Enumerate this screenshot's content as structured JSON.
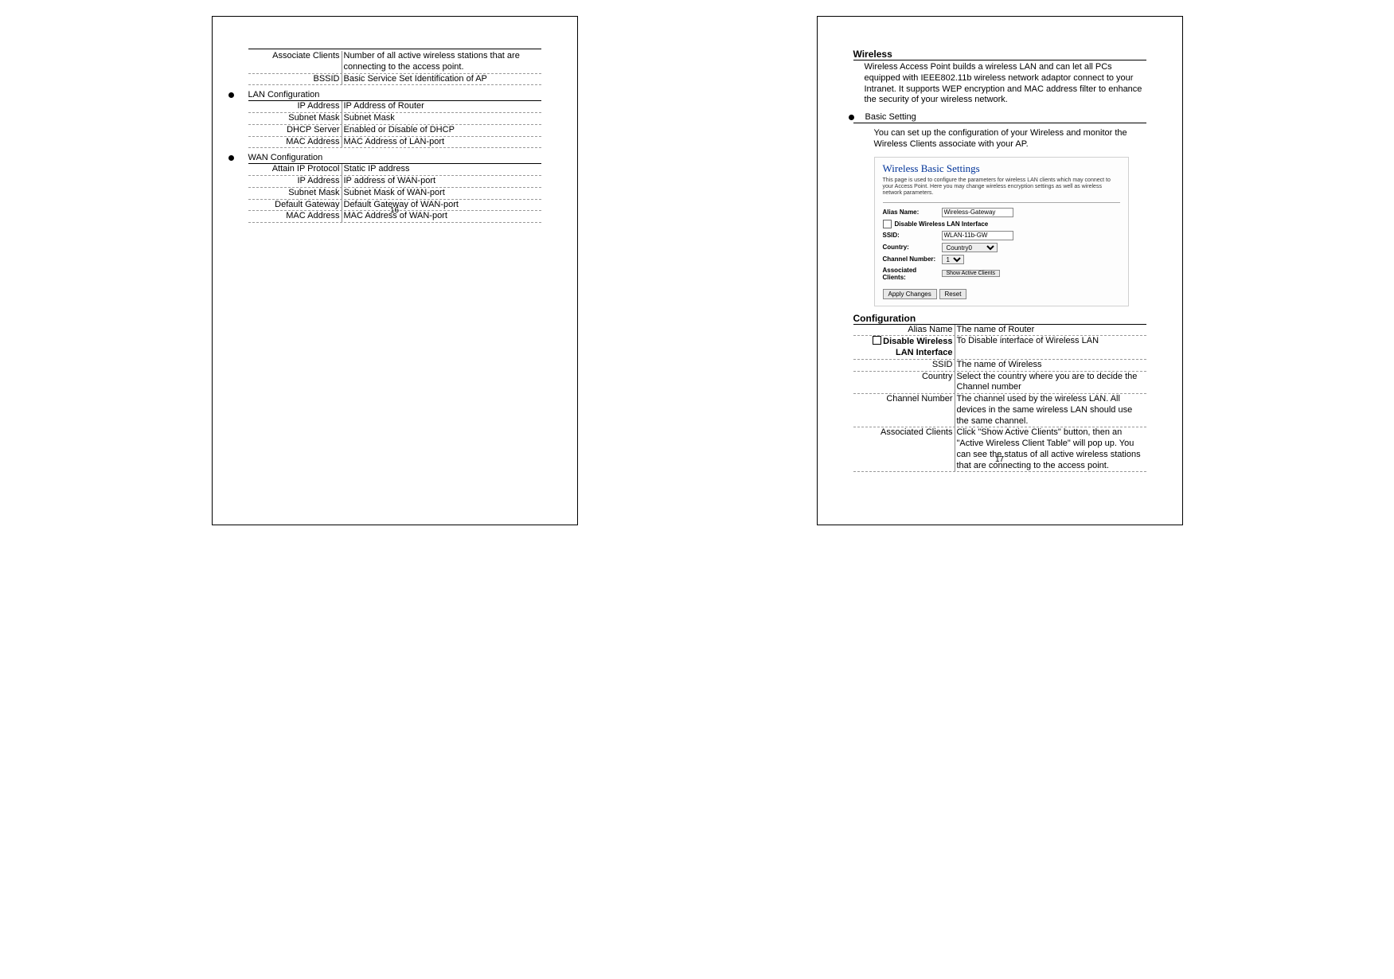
{
  "left": {
    "top_rows": [
      {
        "term": "Associate Clients",
        "val": "Number of all active wireless stations that are connecting to the access point."
      },
      {
        "term": "BSSID",
        "val": "Basic Service Set Identification of AP"
      }
    ],
    "lan_heading": "LAN Configuration",
    "lan_rows": [
      {
        "term": "IP Address",
        "val": "IP Address of Router"
      },
      {
        "term": "Subnet Mask",
        "val": "Subnet Mask"
      },
      {
        "term": "DHCP Server",
        "val": "Enabled or Disable of DHCP"
      },
      {
        "term": "MAC Address",
        "val": "MAC Address of LAN-port"
      }
    ],
    "wan_heading": "WAN Configuration",
    "wan_rows": [
      {
        "term": "Attain IP Protocol",
        "val": "Static IP address"
      },
      {
        "term": "IP Address",
        "val": "IP address of WAN-port"
      },
      {
        "term": "Subnet Mask",
        "val": "Subnet Mask of WAN-port"
      },
      {
        "term": "Default Gateway",
        "val": "Default Gateway of WAN-port"
      },
      {
        "term": "MAC Address",
        "val": "MAC Address of WAN-port"
      }
    ],
    "page_num": "16"
  },
  "right": {
    "wireless_heading": "Wireless",
    "wireless_body": "Wireless Access Point builds a wireless LAN and can let all PCs equipped with IEEE802.11b wireless network adaptor connect to your Intranet. It supports WEP encryption and MAC address filter to enhance the security of your wireless network.",
    "basic_setting_label": "Basic Setting",
    "basic_setting_text": "You can set up the configuration of your Wireless and monitor the Wireless Clients associate with your AP.",
    "wbs": {
      "title": "Wireless Basic Settings",
      "desc": "This page is used to configure the parameters for wireless LAN clients which may connect to your Access Point. Here you may change wireless encryption settings as well as wireless network parameters.",
      "alias_label": "Alias Name:",
      "alias_value": "Wireless-Gateway",
      "disable_label": "Disable Wireless LAN Interface",
      "ssid_label": "SSID:",
      "ssid_value": "WLAN-11b-GW",
      "country_label": "Country:",
      "country_value": "Country0",
      "channel_label": "Channel Number:",
      "channel_value": "1",
      "assoc_label": "Associated Clients:",
      "show_btn": "Show Active Clients",
      "apply_btn": "Apply Changes",
      "reset_btn": "Reset"
    },
    "conf_heading": "Configuration",
    "conf_rows": [
      {
        "term": "Alias Name",
        "checkbox": false,
        "bold": false,
        "val": "The name of Router"
      },
      {
        "term": "Disable Wireless LAN Interface",
        "checkbox": true,
        "bold": true,
        "val": "To Disable interface of Wireless LAN"
      },
      {
        "term": "SSID",
        "checkbox": false,
        "bold": false,
        "val": "The name of Wireless"
      },
      {
        "term": "Country",
        "checkbox": false,
        "bold": false,
        "val": "Select the country where you are to decide the Channel number"
      },
      {
        "term": "Channel Number",
        "checkbox": false,
        "bold": false,
        "val": "The channel used by the wireless LAN. All devices in the same wireless LAN should use the same channel."
      },
      {
        "term": "Associated Clients",
        "checkbox": false,
        "bold": false,
        "val": "Click \"Show Active Clients\" button, then an \"Active Wireless Client Table\" will pop up. You can see the status of all active wireless stations that are connecting to the access point."
      }
    ],
    "page_num": "17"
  }
}
